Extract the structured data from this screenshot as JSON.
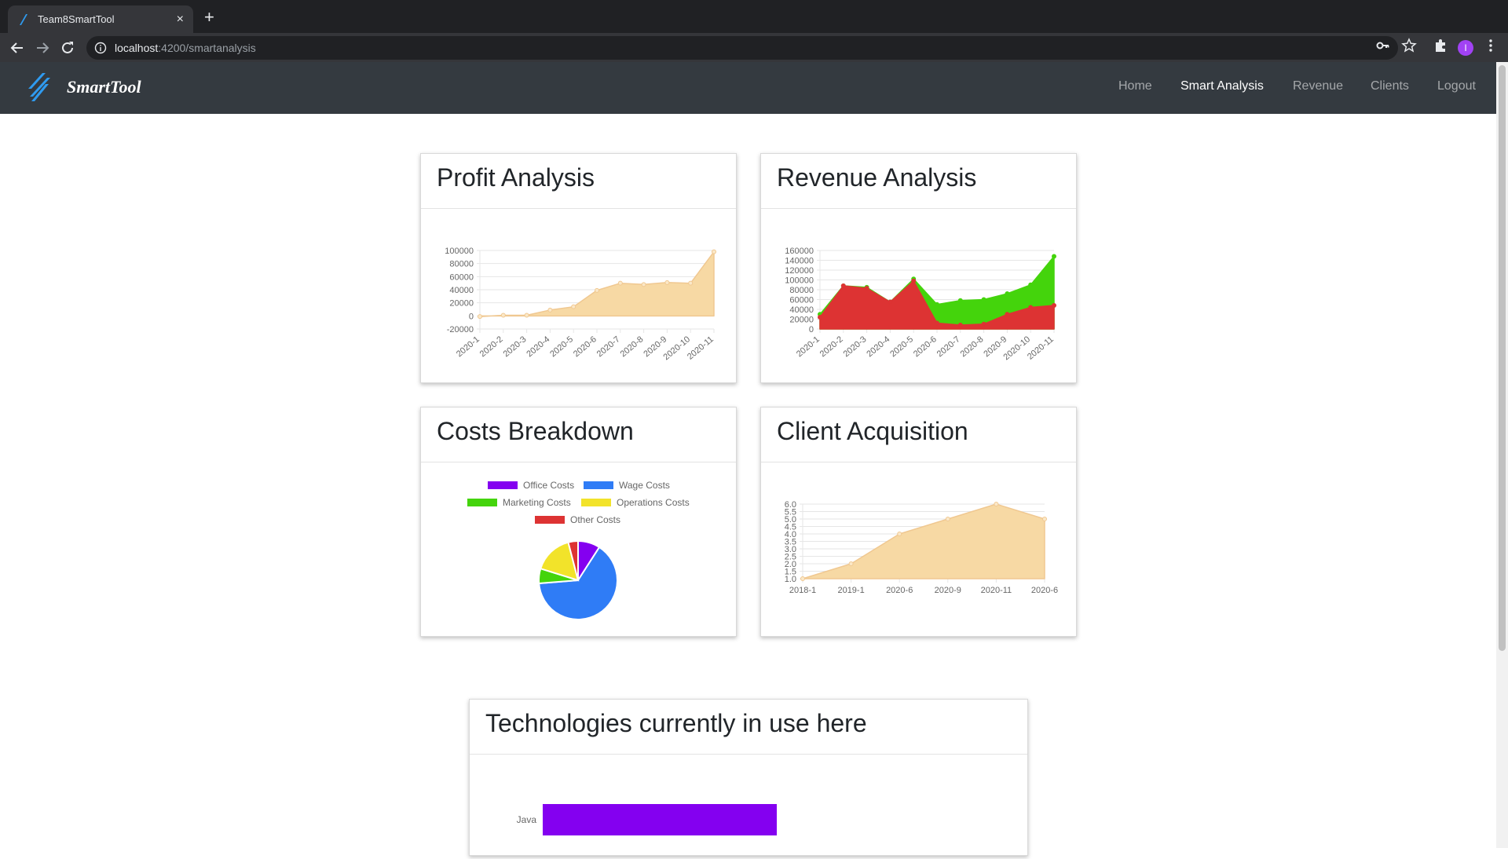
{
  "browser": {
    "tab_title": "Team8SmartTool",
    "new_tab_symbol": "+",
    "close_symbol": "×",
    "url_host": "localhost",
    "url_path": ":4200/smartanalysis",
    "profile_initial": "I"
  },
  "navbar": {
    "brand": "SmartTool",
    "links": [
      "Home",
      "Smart Analysis",
      "Revenue",
      "Clients",
      "Logout"
    ],
    "active": "Smart Analysis"
  },
  "cards": {
    "profit": "Profit Analysis",
    "revenue": "Revenue Analysis",
    "costs": "Costs Breakdown",
    "clients": "Client Acquisition",
    "tech": "Technologies currently in use here"
  },
  "chart_data": [
    {
      "id": "profit",
      "type": "area",
      "categories": [
        "2020-1",
        "2020-2",
        "2020-3",
        "2020-4",
        "2020-5",
        "2020-6",
        "2020-7",
        "2020-8",
        "2020-9",
        "2020-10",
        "2020-11"
      ],
      "series": [
        {
          "values": [
            -1000,
            1000,
            1000,
            9000,
            14000,
            39000,
            50000,
            48000,
            51000,
            50000,
            98000
          ],
          "color": "#f7d9a4"
        }
      ],
      "yticks": [
        100000,
        80000,
        60000,
        40000,
        20000,
        0,
        -20000
      ],
      "ylim": [
        -20000,
        100000
      ],
      "grid": true
    },
    {
      "id": "revenue",
      "type": "area",
      "categories": [
        "2020-1",
        "2020-2",
        "2020-3",
        "2020-4",
        "2020-5",
        "2020-6",
        "2020-7",
        "2020-8",
        "2020-9",
        "2020-10",
        "2020-11"
      ],
      "series": [
        {
          "values": [
            30000,
            88000,
            85000,
            55000,
            102000,
            50000,
            58000,
            60000,
            72000,
            90000,
            148000
          ],
          "color": "#44d40c"
        },
        {
          "values": [
            24000,
            88000,
            83000,
            55000,
            98000,
            12000,
            8000,
            10000,
            30000,
            44000,
            48000
          ],
          "color": "#dd3333"
        }
      ],
      "yticks": [
        160000,
        140000,
        120000,
        100000,
        80000,
        60000,
        40000,
        20000,
        0
      ],
      "ylim": [
        0,
        160000
      ],
      "grid": true
    },
    {
      "id": "costs",
      "type": "pie",
      "legend": [
        {
          "label": "Office Costs",
          "color": "#8400f0"
        },
        {
          "label": "Wage Costs",
          "color": "#2f7cf6"
        },
        {
          "label": "Marketing Costs",
          "color": "#44d40c"
        },
        {
          "label": "Operations Costs",
          "color": "#f2e32a"
        },
        {
          "label": "Other Costs",
          "color": "#dd3333"
        }
      ],
      "values": [
        9,
        64,
        6,
        16,
        4
      ],
      "legend_position": "top"
    },
    {
      "id": "clients",
      "type": "area",
      "categories": [
        "2018-1",
        "2019-1",
        "2020-6",
        "2020-9",
        "2020-11",
        "2020-6"
      ],
      "series": [
        {
          "values": [
            1,
            2,
            4,
            5,
            6,
            5
          ],
          "color": "#f7d9a4"
        }
      ],
      "yticks": [
        6.0,
        5.5,
        5.0,
        4.5,
        4.0,
        3.5,
        3.0,
        2.5,
        2.0,
        1.5,
        1.0
      ],
      "ylim": [
        1,
        6
      ],
      "grid": true
    },
    {
      "id": "tech",
      "type": "bar",
      "orientation": "horizontal",
      "categories": [
        "Java"
      ],
      "values": [
        1
      ],
      "color": "#8400f0"
    }
  ]
}
